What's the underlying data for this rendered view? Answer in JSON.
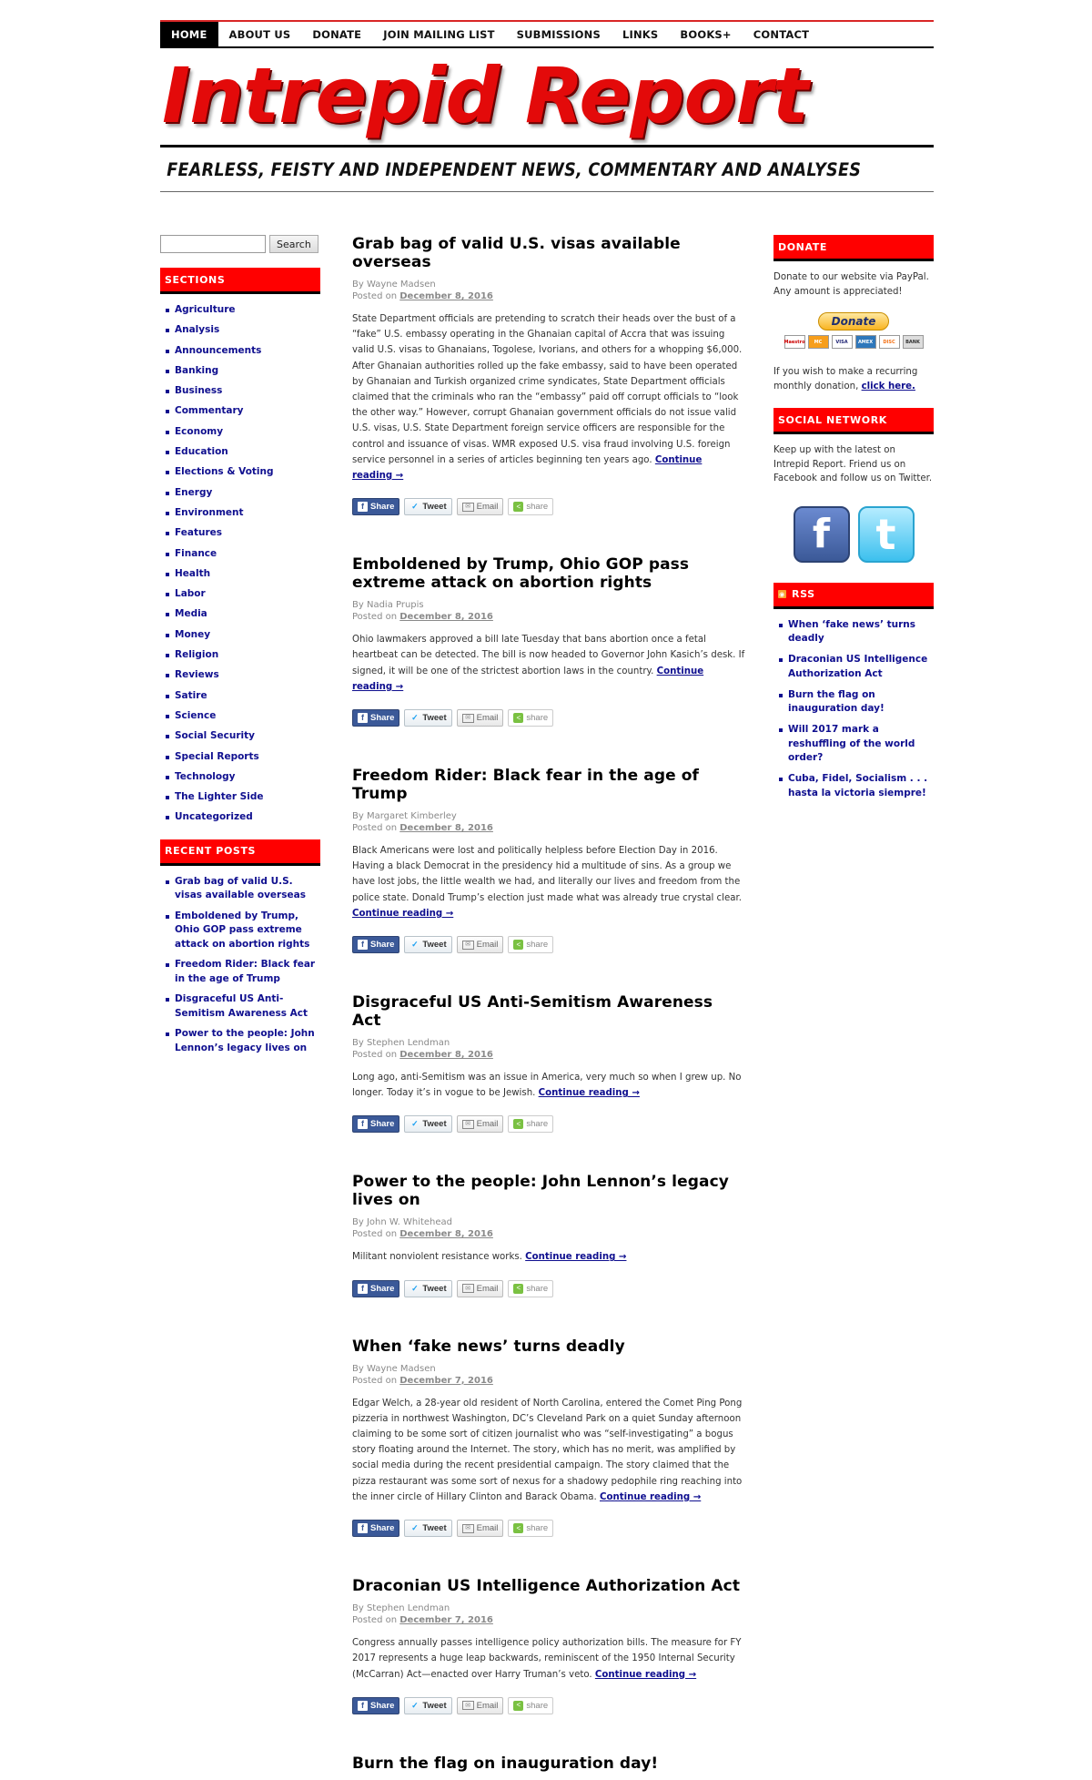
{
  "nav": {
    "items": [
      "HOME",
      "ABOUT US",
      "DONATE",
      "JOIN MAILING LIST",
      "SUBMISSIONS",
      "LINKS",
      "BOOKS+",
      "CONTACT"
    ]
  },
  "masthead": {
    "logo_text": "Intrepid Report",
    "tagline": "FEARLESS, FEISTY AND INDEPENDENT NEWS, COMMENTARY AND ANALYSES"
  },
  "search": {
    "button_label": "Search",
    "placeholder": ""
  },
  "sections": {
    "title": "SECTIONS",
    "items": [
      "Agriculture",
      "Analysis",
      "Announcements",
      "Banking",
      "Business",
      "Commentary",
      "Economy",
      "Education",
      "Elections & Voting",
      "Energy",
      "Environment",
      "Features",
      "Finance",
      "Health",
      "Labor",
      "Media",
      "Money",
      "Religion",
      "Reviews",
      "Satire",
      "Science",
      "Social Security",
      "Special Reports",
      "Technology",
      "The Lighter Side",
      "Uncategorized"
    ]
  },
  "recent_posts": {
    "title": "RECENT POSTS",
    "items": [
      "Grab bag of valid U.S. visas available overseas",
      "Emboldened by Trump, Ohio GOP pass extreme attack on abortion rights",
      "Freedom Rider: Black fear in the age of Trump",
      "Disgraceful US Anti-Semitism Awareness Act",
      "Power to the people: John Lennon’s legacy lives on"
    ]
  },
  "share": {
    "fb": "Share",
    "tw": "Tweet",
    "em": "Email",
    "sh": "share"
  },
  "posts": [
    {
      "title": "Grab bag of valid U.S. visas available overseas",
      "author": "By Wayne Madsen",
      "posted": "Posted on",
      "date": "December 8, 2016",
      "excerpt": "State Department officials are pretending to scratch their heads over the bust of a “fake” U.S. embassy operating in the Ghanaian capital of Accra that was issuing valid U.S. visas to Ghanaians, Togolese, Ivorians, and others for a whopping $6,000. After Ghanaian authorities rolled up the fake embassy, said to have been operated by Ghanaian and Turkish organized crime syndicates, State Department officials claimed that the criminals who ran the “embassy” paid off corrupt officials to “look the other way.” However, corrupt Ghanaian government officials do not issue valid U.S. visas, U.S. State Department foreign service officers are responsible for the control and issuance of visas. WMR exposed U.S. visa fraud involving U.S. foreign service personnel in a series of articles beginning ten years ago.",
      "more": "Continue reading →"
    },
    {
      "title": "Emboldened by Trump, Ohio GOP pass extreme attack on abortion rights",
      "author": "By Nadia Prupis",
      "posted": "Posted on",
      "date": "December 8, 2016",
      "excerpt": "Ohio lawmakers approved a bill late Tuesday that bans abortion once a fetal heartbeat can be detected. The bill is now headed to Governor John Kasich’s desk. If signed, it will be one of the strictest abortion laws in the country.",
      "more": "Continue reading →"
    },
    {
      "title": "Freedom Rider: Black fear in the age of Trump",
      "author": "By Margaret Kimberley",
      "posted": "Posted on",
      "date": "December 8, 2016",
      "excerpt": "Black Americans were lost and politically helpless before Election Day in 2016. Having a black Democrat in the presidency hid a multitude of sins. As a group we have lost jobs, the little wealth we had, and literally our lives and freedom from the police state. Donald Trump’s election just made what was already true crystal clear.",
      "more": "Continue reading →"
    },
    {
      "title": "Disgraceful US Anti-Semitism Awareness Act",
      "author": "By Stephen Lendman",
      "posted": "Posted on",
      "date": "December 8, 2016",
      "excerpt": "Long ago, anti-Semitism was an issue in America, very much so when I grew up. No longer. Today it’s in vogue to be Jewish.",
      "more": "Continue reading →"
    },
    {
      "title": "Power to the people: John Lennon’s legacy lives on",
      "author": "By John W. Whitehead",
      "posted": "Posted on",
      "date": "December 8, 2016",
      "excerpt": "Militant nonviolent resistance works.",
      "more": "Continue reading →"
    },
    {
      "title": "When ‘fake news’ turns deadly",
      "author": "By Wayne Madsen",
      "posted": "Posted on",
      "date": "December 7, 2016",
      "excerpt": "Edgar Welch, a 28-year old resident of North Carolina, entered the Comet Ping Pong pizzeria in northwest Washington, DC’s Cleveland Park on a quiet Sunday afternoon claiming to be some sort of citizen journalist who was “self-investigating” a bogus story floating around the Internet. The story, which has no merit, was amplified by social media during the recent presidential campaign. The story claimed that the pizza restaurant was some sort of nexus for a shadowy pedophile ring reaching into the inner circle of Hillary Clinton and Barack Obama.",
      "more": "Continue reading →"
    },
    {
      "title": "Draconian US Intelligence Authorization Act",
      "author": "By Stephen Lendman",
      "posted": "Posted on",
      "date": "December 7, 2016",
      "excerpt": "Congress annually passes intelligence policy authorization bills. The measure for FY 2017 represents a huge leap backwards, reminiscent of the 1950 Internal Security (McCarran) Act—enacted over Harry Truman’s veto.",
      "more": "Continue reading →"
    },
    {
      "title": "Burn the flag on inauguration day!",
      "author": "",
      "posted": "",
      "date": "",
      "excerpt": "",
      "more": ""
    }
  ],
  "donate": {
    "title": "DONATE",
    "text": "Donate to our website via PayPal. Any amount is appreciated!",
    "button": "Donate",
    "cards": [
      "Maestro",
      "MC",
      "VISA",
      "AMEX",
      "DISC",
      "BANK"
    ],
    "recurring_text": "If you wish to make a recurring monthly donation,",
    "recurring_link": "click here."
  },
  "social": {
    "title": "SOCIAL NETWORK",
    "text": "Keep up with the latest on Intrepid Report. Friend us on Facebook and follow us on Twitter.",
    "fb_glyph": "f",
    "tw_glyph": "t"
  },
  "rss": {
    "title": "RSS",
    "items": [
      "When ‘fake news’ turns deadly",
      "Draconian US Intelligence Authorization Act",
      "Burn the flag on inauguration day!",
      "Will 2017 mark a reshuffling of the world order?",
      "Cuba, Fidel, Socialism . . . hasta la victoria siempre!"
    ]
  }
}
